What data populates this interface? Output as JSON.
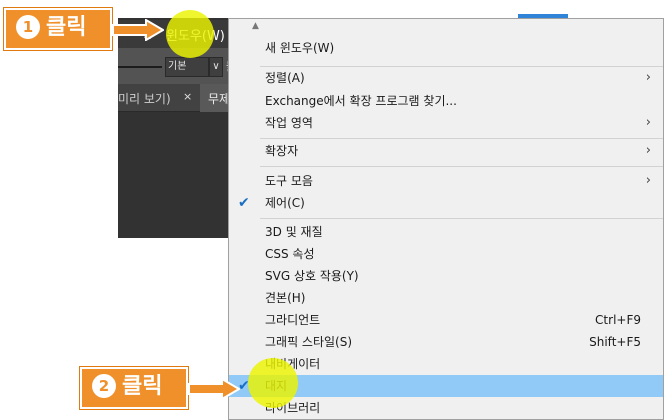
{
  "app": {
    "menubar_prev": "·/)",
    "menubar_window": "윈도우(W)",
    "stroke_style": "기본",
    "dropdown_glyph": "∨",
    "opacity_label": "불",
    "tab_label": "미리 보기)",
    "tab_close": "×",
    "tab_next": "무제"
  },
  "menu": {
    "scroll_up": "▲",
    "items": [
      {
        "label": "새 윈도우(W)",
        "shortcut": "",
        "submenu": false,
        "checked": false,
        "highlighted": false
      },
      {
        "label": "정렬(A)",
        "shortcut": "",
        "submenu": true,
        "checked": false,
        "highlighted": false
      },
      {
        "label": "Exchange에서 확장 프로그램 찾기...",
        "shortcut": "",
        "submenu": false,
        "checked": false,
        "highlighted": false
      },
      {
        "label": "작업 영역",
        "shortcut": "",
        "submenu": true,
        "checked": false,
        "highlighted": false
      },
      {
        "label": "확장자",
        "shortcut": "",
        "submenu": true,
        "checked": false,
        "highlighted": false
      },
      {
        "label": "도구 모음",
        "shortcut": "",
        "submenu": true,
        "checked": false,
        "highlighted": false
      },
      {
        "label": "제어(C)",
        "shortcut": "",
        "submenu": false,
        "checked": true,
        "highlighted": false
      },
      {
        "label": "3D 및 재질",
        "shortcut": "",
        "submenu": false,
        "checked": false,
        "highlighted": false
      },
      {
        "label": "CSS 속성",
        "shortcut": "",
        "submenu": false,
        "checked": false,
        "highlighted": false
      },
      {
        "label": "SVG 상호 작용(Y)",
        "shortcut": "",
        "submenu": false,
        "checked": false,
        "highlighted": false
      },
      {
        "label": "견본(H)",
        "shortcut": "",
        "submenu": false,
        "checked": false,
        "highlighted": false
      },
      {
        "label": "그라디언트",
        "shortcut": "Ctrl+F9",
        "submenu": false,
        "checked": false,
        "highlighted": false
      },
      {
        "label": "그래픽 스타일(S)",
        "shortcut": "Shift+F5",
        "submenu": false,
        "checked": false,
        "highlighted": false
      },
      {
        "label": "내비게이터",
        "shortcut": "",
        "submenu": false,
        "checked": false,
        "highlighted": false
      },
      {
        "label": "대지",
        "shortcut": "",
        "submenu": false,
        "checked": true,
        "highlighted": true
      },
      {
        "label": "라이브러리",
        "shortcut": "",
        "submenu": false,
        "checked": false,
        "highlighted": false
      }
    ],
    "submenu_glyph": "›",
    "check_glyph": "✔"
  },
  "annotations": {
    "step1_number": "1",
    "step1_text": "클릭",
    "step2_number": "2",
    "step2_text": "클릭"
  },
  "colors": {
    "highlight": "#91c9f7",
    "callout": "#f0902a",
    "spot": "#ecf400",
    "app_dark": "#323232"
  }
}
